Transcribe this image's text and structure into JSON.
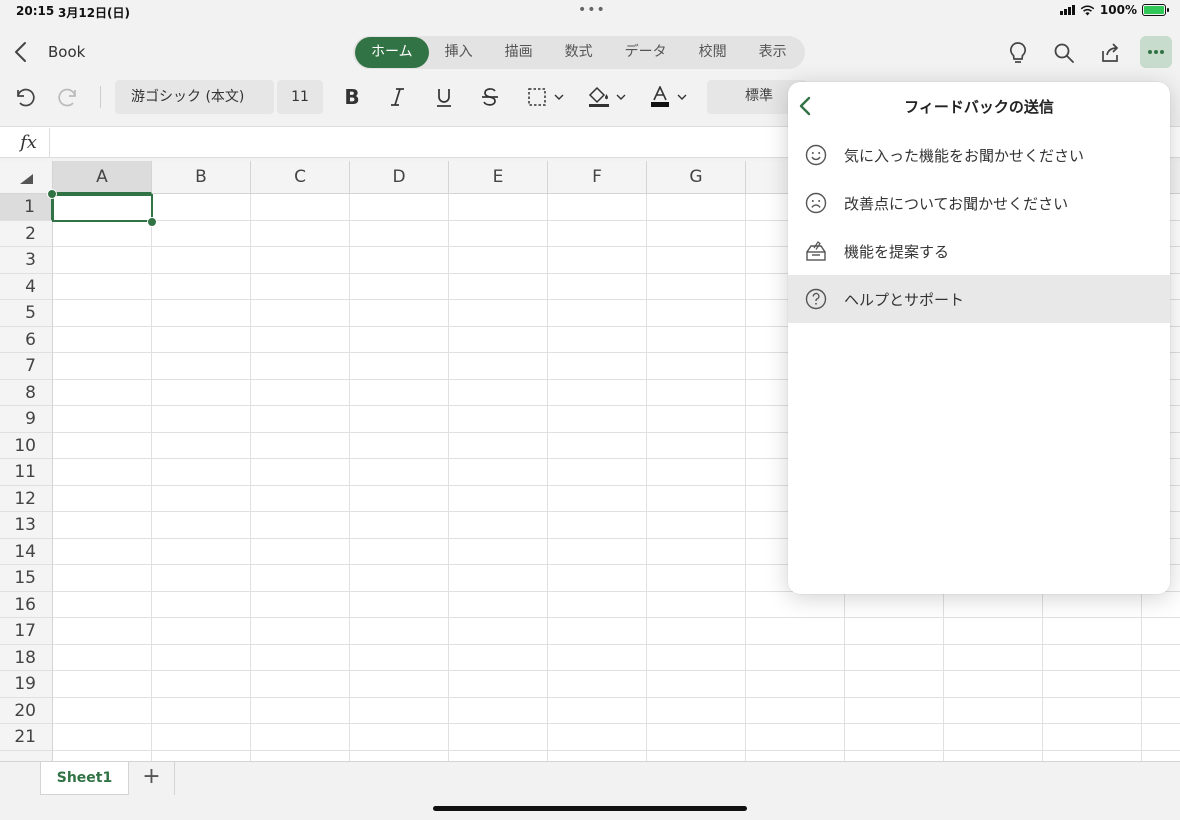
{
  "status": {
    "time": "20:15",
    "date": "3月12日(日)",
    "battery": "100%"
  },
  "nav": {
    "doc_title": "Book",
    "tabs": [
      {
        "label": "ホーム",
        "active": true
      },
      {
        "label": "挿入"
      },
      {
        "label": "描画"
      },
      {
        "label": "数式"
      },
      {
        "label": "データ"
      },
      {
        "label": "校閲"
      },
      {
        "label": "表示"
      }
    ]
  },
  "toolbar": {
    "font": "游ゴシック (本文)",
    "size": "11",
    "number_format": "標準"
  },
  "formula": {
    "fx_label": "fx",
    "value": ""
  },
  "grid": {
    "columns": [
      "A",
      "B",
      "C",
      "D",
      "E",
      "F",
      "G"
    ],
    "rows": [
      "1",
      "2",
      "3",
      "4",
      "5",
      "6",
      "7",
      "8",
      "9",
      "10",
      "11",
      "12",
      "13",
      "14",
      "15",
      "16",
      "17",
      "18",
      "19",
      "20",
      "21"
    ],
    "selected_cell": "A1"
  },
  "sheets": {
    "tabs": [
      "Sheet1"
    ],
    "add_label": "+"
  },
  "popover": {
    "title": "フィードバックの送信",
    "items": [
      {
        "label": "気に入った機能をお聞かせください",
        "icon": "smile-icon"
      },
      {
        "label": "改善点についてお聞かせください",
        "icon": "frown-icon"
      },
      {
        "label": "機能を提案する",
        "icon": "suggestion-box-icon"
      },
      {
        "label": "ヘルプとサポート",
        "icon": "help-circle-icon",
        "highlighted": true
      }
    ]
  },
  "colors": {
    "accent": "#327345",
    "accent_light": "#c8dccd"
  }
}
